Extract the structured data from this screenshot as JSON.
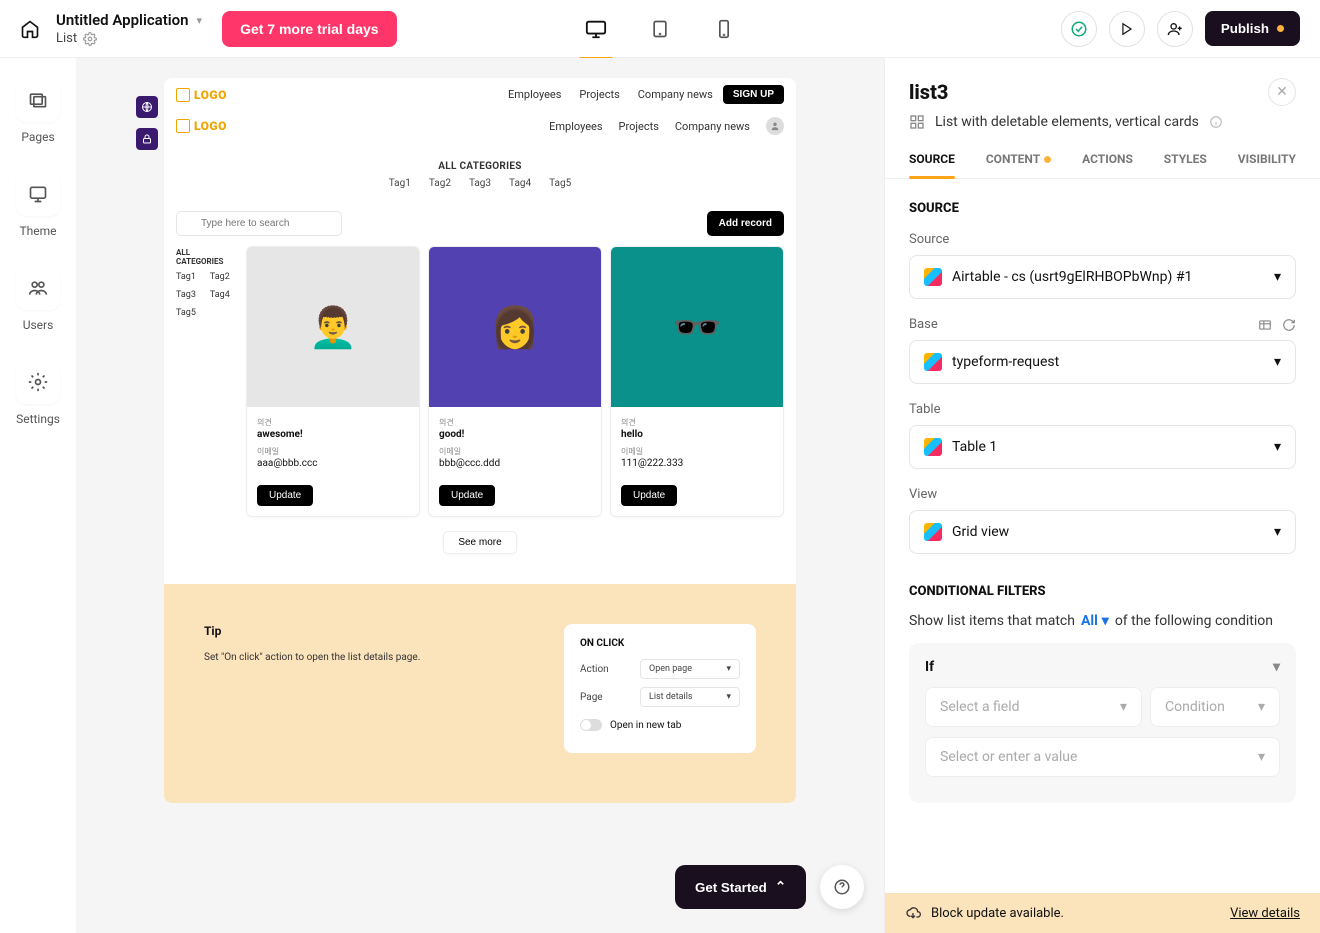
{
  "topbar": {
    "app_title": "Untitled Application",
    "page_label": "List",
    "trial_button": "Get 7 more trial days",
    "publish": "Publish"
  },
  "leftrail": {
    "items": [
      "Pages",
      "Theme",
      "Users",
      "Settings"
    ]
  },
  "preview": {
    "logo": "LOGO",
    "nav": [
      "Employees",
      "Projects",
      "Company news"
    ],
    "signup": "SIGN UP",
    "all_categories": "ALL CATEGORIES",
    "tags": [
      "Tag1",
      "Tag2",
      "Tag3",
      "Tag4",
      "Tag5"
    ],
    "search_placeholder": "Type here to search",
    "add_record": "Add record",
    "side_all": "ALL CATEGORIES",
    "side_tags": [
      "Tag1",
      "Tag2",
      "Tag3",
      "Tag4",
      "Tag5"
    ],
    "cards": [
      {
        "label1": "의견",
        "value1": "awesome!",
        "label2": "이메일",
        "value2": "aaa@bbb.ccc",
        "btn": "Update"
      },
      {
        "label1": "의견",
        "value1": "good!",
        "label2": "이메일",
        "value2": "bbb@ccc.ddd",
        "btn": "Update"
      },
      {
        "label1": "의견",
        "value1": "hello",
        "label2": "이메일",
        "value2": "111@222.333",
        "btn": "Update"
      }
    ],
    "see_more": "See more"
  },
  "tip": {
    "title": "Tip",
    "text": "Set \"On click\" action to open the list details page.",
    "on_click": "ON CLICK",
    "action_label": "Action",
    "action_value": "Open page",
    "page_label": "Page",
    "page_value": "List details",
    "open_new_tab": "Open in new tab"
  },
  "panel": {
    "title": "list3",
    "subtitle": "List with deletable elements, vertical cards",
    "tabs": [
      "SOURCE",
      "CONTENT",
      "ACTIONS",
      "STYLES",
      "VISIBILITY"
    ],
    "section_source": "SOURCE",
    "form": {
      "source_label": "Source",
      "source_value": "Airtable - cs (usrt9gElRHBOPbWnp) #1",
      "base_label": "Base",
      "base_value": "typeform-request",
      "table_label": "Table",
      "table_value": "Table 1",
      "view_label": "View",
      "view_value": "Grid view"
    },
    "cond": {
      "title": "CONDITIONAL FILTERS",
      "text1": "Show list items that match",
      "all": "All",
      "text2": "of the following condition",
      "if": "If",
      "select_field": "Select a field",
      "condition": "Condition",
      "select_value": "Select or enter a value"
    },
    "banner": {
      "text": "Block update available.",
      "link": "View details"
    }
  },
  "footer": {
    "get_started": "Get Started"
  }
}
